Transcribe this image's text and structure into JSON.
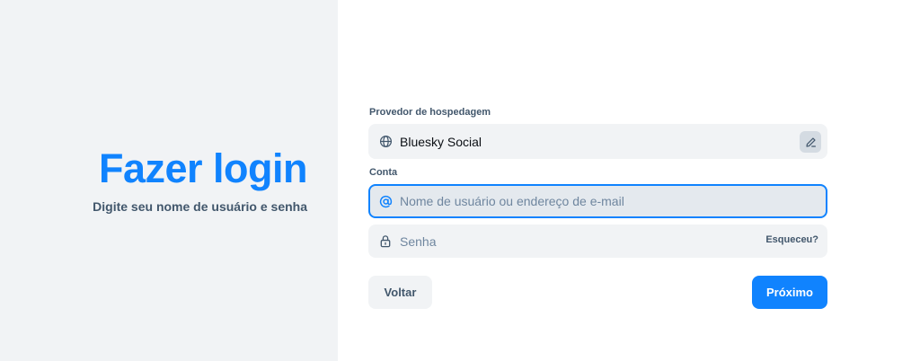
{
  "intro": {
    "title": "Fazer login",
    "subtitle": "Digite seu nome de usuário e senha"
  },
  "hosting": {
    "label": "Provedor de hospedagem",
    "value": "Bluesky Social",
    "icon": "globe-icon",
    "edit_icon": "pencil-icon"
  },
  "account": {
    "label": "Conta",
    "placeholder": "Nome de usuário ou endereço de e-mail",
    "icon": "at-sign-icon"
  },
  "password": {
    "placeholder": "Senha",
    "icon": "lock-icon",
    "forgot_label": "Esqueceu?"
  },
  "actions": {
    "back_label": "Voltar",
    "next_label": "Próximo"
  },
  "colors": {
    "accent": "#1083fe",
    "panel_background": "#f1f3f5",
    "muted_text": "#42576c",
    "placeholder_text": "#6f869f"
  }
}
